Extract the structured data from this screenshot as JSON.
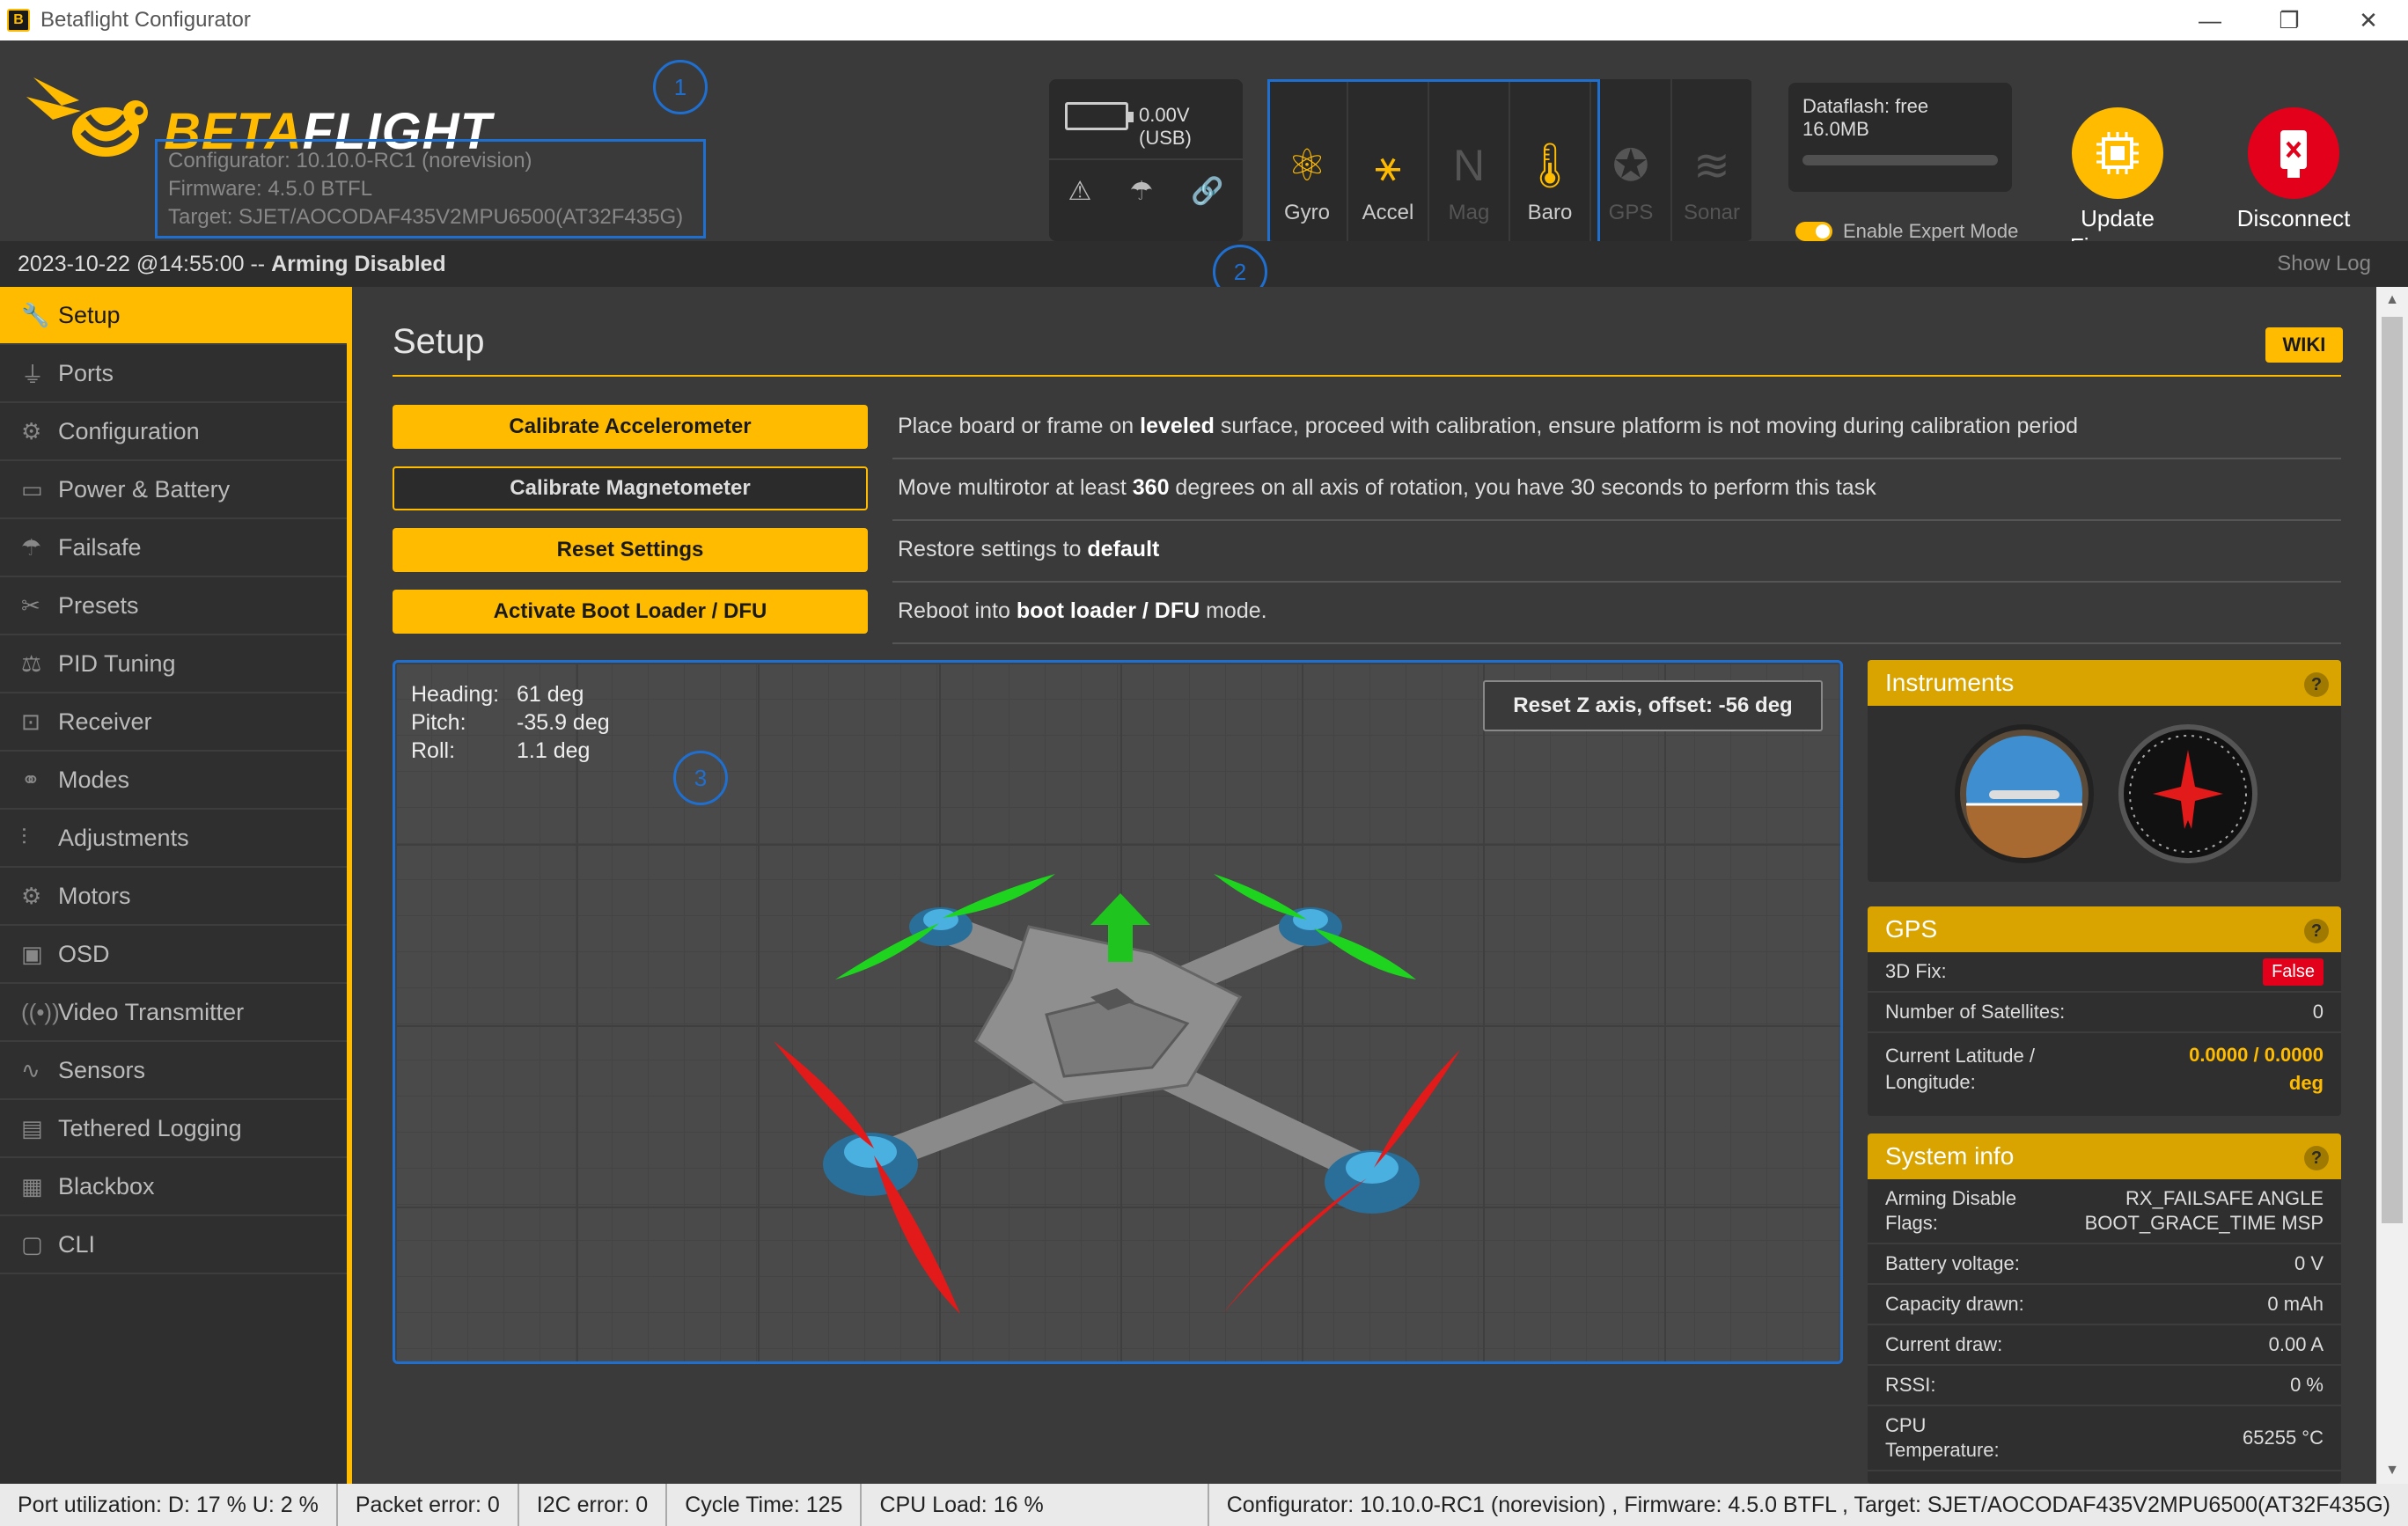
{
  "window": {
    "title": "Betaflight Configurator",
    "minimize": "—",
    "maximize": "❐",
    "close": "✕"
  },
  "header": {
    "logo_beta": "BETA",
    "logo_flight": "FLIGHT",
    "configurator_version": "Configurator: 10.10.0-RC1 (norevision)",
    "firmware_version": "Firmware: 4.5.0 BTFL",
    "target": "Target: SJET/AOCODAF435V2MPU6500(AT32F435G)",
    "battery_voltage": "0.00V (USB)",
    "sensors": [
      {
        "label": "Gyro",
        "icon": "⚛",
        "active": true
      },
      {
        "label": "Accel",
        "icon": "⚹",
        "active": true
      },
      {
        "label": "Mag",
        "icon": "N",
        "active": false
      },
      {
        "label": "Baro",
        "icon": "🌡",
        "active": true
      },
      {
        "label": "GPS",
        "icon": "✪",
        "active": false
      },
      {
        "label": "Sonar",
        "icon": "≋",
        "active": false
      }
    ],
    "dataflash": "Dataflash: free 16.0MB",
    "expert_mode_label": "Enable Expert Mode",
    "update_firmware_label": "Update\nFirmware",
    "disconnect_label": "Disconnect",
    "annotations": [
      "1",
      "2",
      "3"
    ]
  },
  "status": {
    "datetime": "2023-10-22 @14:55:00 -- ",
    "arming": "Arming Disabled",
    "show_log": "Show Log"
  },
  "sidebar": {
    "items": [
      {
        "label": "Setup",
        "icon": "🔧"
      },
      {
        "label": "Ports",
        "icon": "⏚"
      },
      {
        "label": "Configuration",
        "icon": "⚙"
      },
      {
        "label": "Power & Battery",
        "icon": "▭"
      },
      {
        "label": "Failsafe",
        "icon": "☂"
      },
      {
        "label": "Presets",
        "icon": "✂"
      },
      {
        "label": "PID Tuning",
        "icon": "⚖"
      },
      {
        "label": "Receiver",
        "icon": "⊡"
      },
      {
        "label": "Modes",
        "icon": "⚭"
      },
      {
        "label": "Adjustments",
        "icon": "⫶"
      },
      {
        "label": "Motors",
        "icon": "⚙"
      },
      {
        "label": "OSD",
        "icon": "▣"
      },
      {
        "label": "Video Transmitter",
        "icon": "((•))"
      },
      {
        "label": "Sensors",
        "icon": "∿"
      },
      {
        "label": "Tethered Logging",
        "icon": "▤"
      },
      {
        "label": "Blackbox",
        "icon": "▦"
      },
      {
        "label": "CLI",
        "icon": "▢"
      }
    ]
  },
  "main": {
    "title": "Setup",
    "wiki": "WIKI",
    "actions": [
      {
        "button": "Calibrate Accelerometer",
        "style": "yellow",
        "desc_before": "Place board or frame on ",
        "desc_bold": "leveled",
        "desc_after": " surface, proceed with calibration, ensure platform is not moving during calibration period"
      },
      {
        "button": "Calibrate Magnetometer",
        "style": "ghost",
        "desc_before": "Move multirotor at least ",
        "desc_bold": "360",
        "desc_after": " degrees on all axis of rotation, you have 30 seconds to perform this task"
      },
      {
        "button": "Reset Settings",
        "style": "yellow",
        "desc_before": "Restore settings to ",
        "desc_bold": "default",
        "desc_after": ""
      },
      {
        "button": "Activate Boot Loader / DFU",
        "style": "yellow",
        "desc_before": "Reboot into ",
        "desc_bold": "boot loader / DFU",
        "desc_after": " mode."
      }
    ],
    "attitude": {
      "heading_label": "Heading:",
      "heading_value": "61 deg",
      "pitch_label": "Pitch:",
      "pitch_value": "-35.9 deg",
      "roll_label": "Roll:",
      "roll_value": "1.1 deg"
    },
    "reset_z": "Reset Z axis, offset: -56 deg"
  },
  "instruments": {
    "title": "Instruments",
    "help": "?"
  },
  "gps": {
    "title": "GPS",
    "help": "?",
    "fix_label": "3D Fix:",
    "fix_value": "False",
    "sats_label": "Number of Satellites:",
    "sats_value": "0",
    "latlon_label": "Current Latitude / Longitude:",
    "latlon_value": "0.0000 / 0.0000",
    "latlon_unit": "deg"
  },
  "system_info": {
    "title": "System info",
    "help": "?",
    "rows": [
      {
        "label": "Arming Disable Flags:",
        "value": "RX_FAILSAFE  ANGLE BOOT_GRACE_TIME  MSP"
      },
      {
        "label": "Battery voltage:",
        "value": "0 V"
      },
      {
        "label": "Capacity drawn:",
        "value": "0 mAh"
      },
      {
        "label": "Current draw:",
        "value": "0.00 A"
      },
      {
        "label": "RSSI:",
        "value": "0 %"
      },
      {
        "label": "CPU Temperature:",
        "value": "65255 °C"
      }
    ]
  },
  "footer": {
    "port_util": "Port utilization: D: 17 % U: 2 %",
    "packet_error": "Packet error: 0",
    "i2c_error": "I2C error: 0",
    "cycle_time": "Cycle Time: 125",
    "cpu_load": "CPU Load: 16 %",
    "versions": "Configurator: 10.10.0-RC1 (norevision) , Firmware: 4.5.0 BTFL , Target: SJET/AOCODAF435V2MPU6500(AT32F435G)"
  },
  "colors": {
    "accent": "#ffbb00",
    "danger": "#e2001a",
    "annotation": "#1f6fd1"
  }
}
